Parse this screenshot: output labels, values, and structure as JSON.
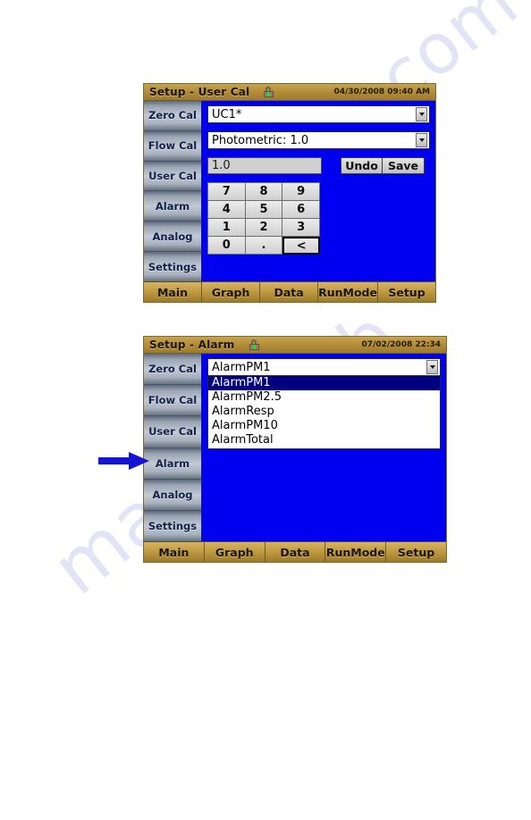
{
  "watermarks": {
    "top_right": "ls.com",
    "bottom_left": "manualslib"
  },
  "screens": [
    {
      "id": "user-cal",
      "titlebar": {
        "title": "Setup - User Cal",
        "lock_icon": "padlock-icon",
        "clock": "04/30/2008 09:40 AM"
      },
      "sidebar": {
        "items": [
          {
            "label": "Zero Cal"
          },
          {
            "label": "Flow Cal"
          },
          {
            "label": "User Cal"
          },
          {
            "label": "Alarm"
          },
          {
            "label": "Analog"
          },
          {
            "label": "Settings"
          }
        ]
      },
      "content": {
        "cal_select": {
          "value": "UC1*",
          "arrow_icon": "chevron-down-icon"
        },
        "mode_select": {
          "value": "Photometric: 1.0",
          "arrow_icon": "chevron-down-icon"
        },
        "value_field": {
          "value": "1.0",
          "placeholder": "1.0"
        },
        "undo_label": "Undo",
        "save_label": "Save",
        "keypad": {
          "keys": [
            "7",
            "8",
            "9",
            "4",
            "5",
            "6",
            "1",
            "2",
            "3",
            "0",
            ".",
            "<"
          ],
          "focused_index": 11
        }
      },
      "navbar": {
        "items": [
          {
            "label": "Main"
          },
          {
            "label": "Graph"
          },
          {
            "label": "Data"
          },
          {
            "label": "RunMode"
          },
          {
            "label": "Setup"
          }
        ]
      }
    },
    {
      "id": "alarm",
      "titlebar": {
        "title": "Setup - Alarm",
        "lock_icon": "padlock-icon",
        "clock": "07/02/2008 22:34"
      },
      "sidebar": {
        "items": [
          {
            "label": "Zero Cal"
          },
          {
            "label": "Flow Cal"
          },
          {
            "label": "User Cal"
          },
          {
            "label": "Alarm"
          },
          {
            "label": "Analog"
          },
          {
            "label": "Settings"
          }
        ]
      },
      "content": {
        "alarm_select": {
          "value": "AlarmPM1",
          "arrow_icon": "chevron-down-icon"
        },
        "dropdown_options": [
          {
            "label": "AlarmPM1",
            "selected": true
          },
          {
            "label": "AlarmPM2.5",
            "selected": false
          },
          {
            "label": "AlarmResp",
            "selected": false
          },
          {
            "label": "AlarmPM10",
            "selected": false
          },
          {
            "label": "AlarmTotal",
            "selected": false
          }
        ]
      },
      "navbar": {
        "items": [
          {
            "label": "Main"
          },
          {
            "label": "Graph"
          },
          {
            "label": "Data"
          },
          {
            "label": "RunMode"
          },
          {
            "label": "Setup"
          }
        ]
      },
      "callout": {
        "arrow_icon": "right-arrow-icon",
        "points_at": "Alarm",
        "color": "#1414d2"
      }
    }
  ]
}
